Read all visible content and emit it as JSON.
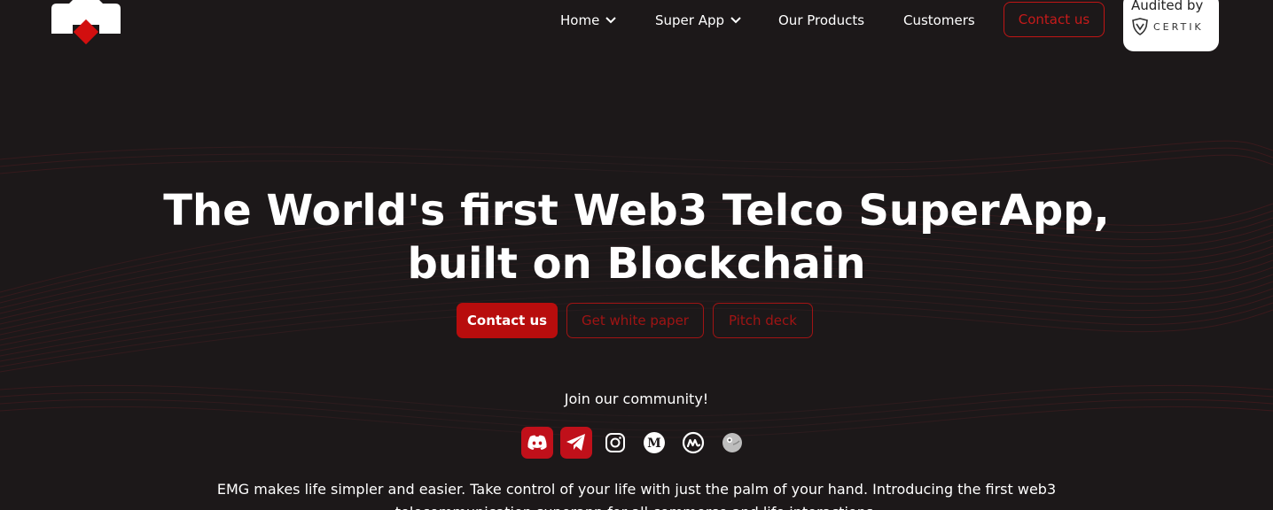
{
  "brand": {
    "logo_icon": "emg-logo-icon",
    "accent_color": "#c01515",
    "background_color": "#1c1819"
  },
  "nav": {
    "items": [
      {
        "label": "Home",
        "has_dropdown": true
      },
      {
        "label": "Super App",
        "has_dropdown": true
      },
      {
        "label": "Our Products",
        "has_dropdown": false
      },
      {
        "label": "Customers",
        "has_dropdown": false
      }
    ],
    "contact_label": "Contact us"
  },
  "audit_badge": {
    "label": "Audited by",
    "brand": "CERTIK",
    "icon": "certik-shield-icon"
  },
  "hero": {
    "title_line1": "The World's first Web3 Telco SuperApp,",
    "title_line2": "built on Blockchain",
    "buttons": {
      "contact": "Contact us",
      "white_paper": "Get white paper",
      "pitch_deck": "Pitch deck"
    }
  },
  "community": {
    "label": "Join our community!",
    "socials": [
      {
        "name": "discord",
        "icon": "discord-icon"
      },
      {
        "name": "telegram",
        "icon": "telegram-icon"
      },
      {
        "name": "instagram",
        "icon": "instagram-icon"
      },
      {
        "name": "medium",
        "icon": "medium-icon"
      },
      {
        "name": "coinmarketcap",
        "icon": "coinmarketcap-icon"
      },
      {
        "name": "coingecko",
        "icon": "coingecko-icon"
      }
    ]
  },
  "description": "EMG makes life simpler and easier. Take control of your life with just the palm of your hand. Introducing the first web3 telecommunication superapp for all commerce and life interactions."
}
